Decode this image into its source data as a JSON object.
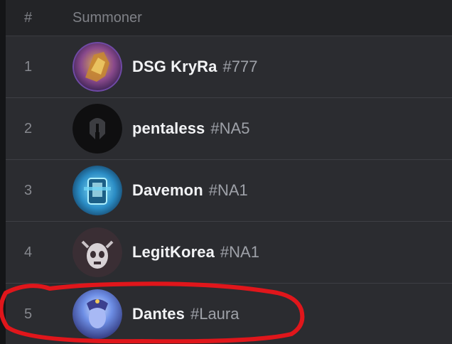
{
  "header": {
    "rank_label": "#",
    "summoner_label": "Summoner"
  },
  "rows": [
    {
      "rank": "1",
      "name": "DSG KryRa",
      "tag": "#777",
      "avatar_icon": "golden-champion-icon"
    },
    {
      "rank": "2",
      "name": "pentaless",
      "tag": "#NA5",
      "avatar_icon": "spartan-helmet-icon"
    },
    {
      "rank": "3",
      "name": "Davemon",
      "tag": "#NA1",
      "avatar_icon": "blue-totem-icon"
    },
    {
      "rank": "4",
      "name": "LegitKorea",
      "tag": "#NA1",
      "avatar_icon": "skull-mask-icon"
    },
    {
      "rank": "5",
      "name": "Dantes",
      "tag": "#Laura",
      "avatar_icon": "blue-sorceress-icon"
    }
  ],
  "colors": {
    "background": "#2b2c30",
    "header_bg": "#232427",
    "name_text": "#f2f3f5",
    "tag_text": "#9ea1a8",
    "annotation": "#e0161b"
  }
}
